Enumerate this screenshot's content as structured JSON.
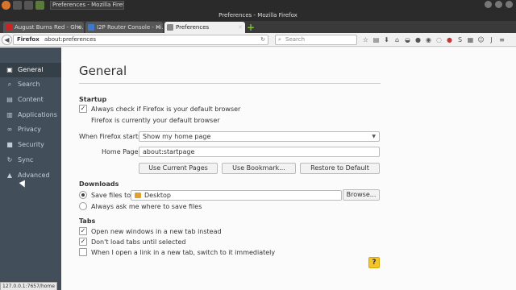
{
  "system_bar": {
    "window_button_label": "Preferences - Mozilla Firefox",
    "icons": [
      "firefox-icon",
      "terminal-icon",
      "folder-icon",
      "ubuntu-icon"
    ]
  },
  "window": {
    "title": "Preferences - Mozilla Firefox"
  },
  "tabs": [
    {
      "label": "August Burns Red - Gho...",
      "favicon": "youtube-icon",
      "color": "#cc2222"
    },
    {
      "label": "I2P Router Console - Hi...",
      "favicon": "i2p-icon",
      "color": "#3a7acc"
    },
    {
      "label": "Preferences",
      "favicon": "gear-icon",
      "color": "#888888"
    }
  ],
  "navbar": {
    "identity": "Firefox",
    "url": "about:preferences",
    "search_placeholder": "Search"
  },
  "sidebar": {
    "items": [
      {
        "label": "General",
        "icon": "general-icon"
      },
      {
        "label": "Search",
        "icon": "search-icon"
      },
      {
        "label": "Content",
        "icon": "content-icon"
      },
      {
        "label": "Applications",
        "icon": "applications-icon"
      },
      {
        "label": "Privacy",
        "icon": "mask-icon"
      },
      {
        "label": "Security",
        "icon": "lock-icon"
      },
      {
        "label": "Sync",
        "icon": "sync-icon"
      },
      {
        "label": "Advanced",
        "icon": "wizard-hat-icon"
      }
    ],
    "active_index": 0
  },
  "status_url": "127.0.0.1:7657/home",
  "main": {
    "title": "General",
    "startup": {
      "heading": "Startup",
      "default_browser_check": "Always check if Firefox is your default browser",
      "default_browser_checked": true,
      "default_status": "Firefox is currently your default browser",
      "when_starts_label": "When Firefox starts:",
      "when_starts_value": "Show my home page",
      "home_page_label": "Home Page:",
      "home_page_value": "about:startpage",
      "use_current": "Use Current Pages",
      "use_bookmark": "Use Bookmark...",
      "restore_default": "Restore to Default"
    },
    "downloads": {
      "heading": "Downloads",
      "save_files_to": "Save files to",
      "folder": "Desktop",
      "browse": "Browse...",
      "always_ask": "Always ask me where to save files",
      "selected": "save_files_to"
    },
    "tabs_section": {
      "heading": "Tabs",
      "open_new_windows": "Open new windows in a new tab instead",
      "open_new_windows_checked": true,
      "dont_load": "Don't load tabs until selected",
      "dont_load_checked": true,
      "switch_to": "When I open a link in a new tab, switch to it immediately",
      "switch_to_checked": false
    },
    "help_label": "?"
  }
}
